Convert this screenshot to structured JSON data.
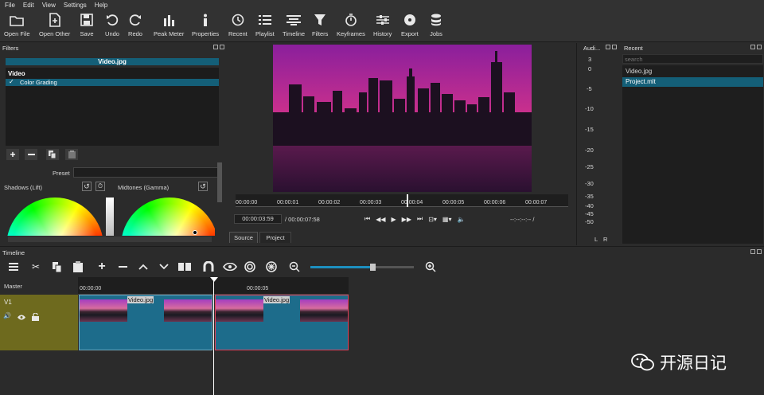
{
  "menu": [
    "File",
    "Edit",
    "View",
    "Settings",
    "Help"
  ],
  "toolbar": [
    {
      "label": "Open File",
      "icon": "open-file-icon"
    },
    {
      "label": "Open Other",
      "icon": "open-other-icon"
    },
    {
      "label": "Save",
      "icon": "save-icon"
    },
    {
      "label": "Undo",
      "icon": "undo-icon"
    },
    {
      "label": "Redo",
      "icon": "redo-icon"
    },
    {
      "label": "Peak Meter",
      "icon": "peak-meter-icon"
    },
    {
      "label": "Properties",
      "icon": "properties-icon"
    },
    {
      "label": "Recent",
      "icon": "recent-icon"
    },
    {
      "label": "Playlist",
      "icon": "playlist-icon"
    },
    {
      "label": "Timeline",
      "icon": "timeline-icon"
    },
    {
      "label": "Filters",
      "icon": "filters-icon"
    },
    {
      "label": "Keyframes",
      "icon": "keyframes-icon"
    },
    {
      "label": "History",
      "icon": "history-icon"
    },
    {
      "label": "Export",
      "icon": "export-icon"
    },
    {
      "label": "Jobs",
      "icon": "jobs-icon"
    }
  ],
  "filters": {
    "title": "Filters",
    "clip_name": "Video.jpg",
    "section": "Video",
    "item": "Color Grading",
    "preset_label": "Preset",
    "shadows_label": "Shadows (Lift)",
    "midtones_label": "Midtones (Gamma)"
  },
  "player": {
    "ruler": [
      "00:00:00",
      "00:00:01",
      "00:00:02",
      "00:00:03",
      "00:00:04",
      "00:00:05",
      "00:00:06",
      "00:00:07"
    ],
    "position": "00:00:03:59",
    "duration": "/ 00:00:07:58",
    "inout": "--:--:--:-- /",
    "tabs": [
      "Source",
      "Project"
    ]
  },
  "audio": {
    "title": "Audi...",
    "scale": [
      "3",
      "0",
      "-5",
      "-10",
      "-15",
      "-20",
      "-25",
      "-30",
      "-35",
      "-40",
      "-45",
      "-50"
    ],
    "channels": [
      "L",
      "R"
    ]
  },
  "recent": {
    "title": "Recent",
    "search_placeholder": "search",
    "items": [
      "Video.jpg",
      "Project.mlt"
    ]
  },
  "timeline": {
    "title": "Timeline",
    "master_label": "Master",
    "track_label": "V1",
    "ruler": [
      "00:00:00",
      "00:00:05"
    ],
    "clip1_name": "Video.jpg",
    "clip2_name": "Video.jpg",
    "zoom_level": 0.6
  },
  "watermark": "开源日记",
  "colors": {
    "accent": "#145f78",
    "track": "#6e6a1e",
    "clip": "#1d6c8b"
  }
}
